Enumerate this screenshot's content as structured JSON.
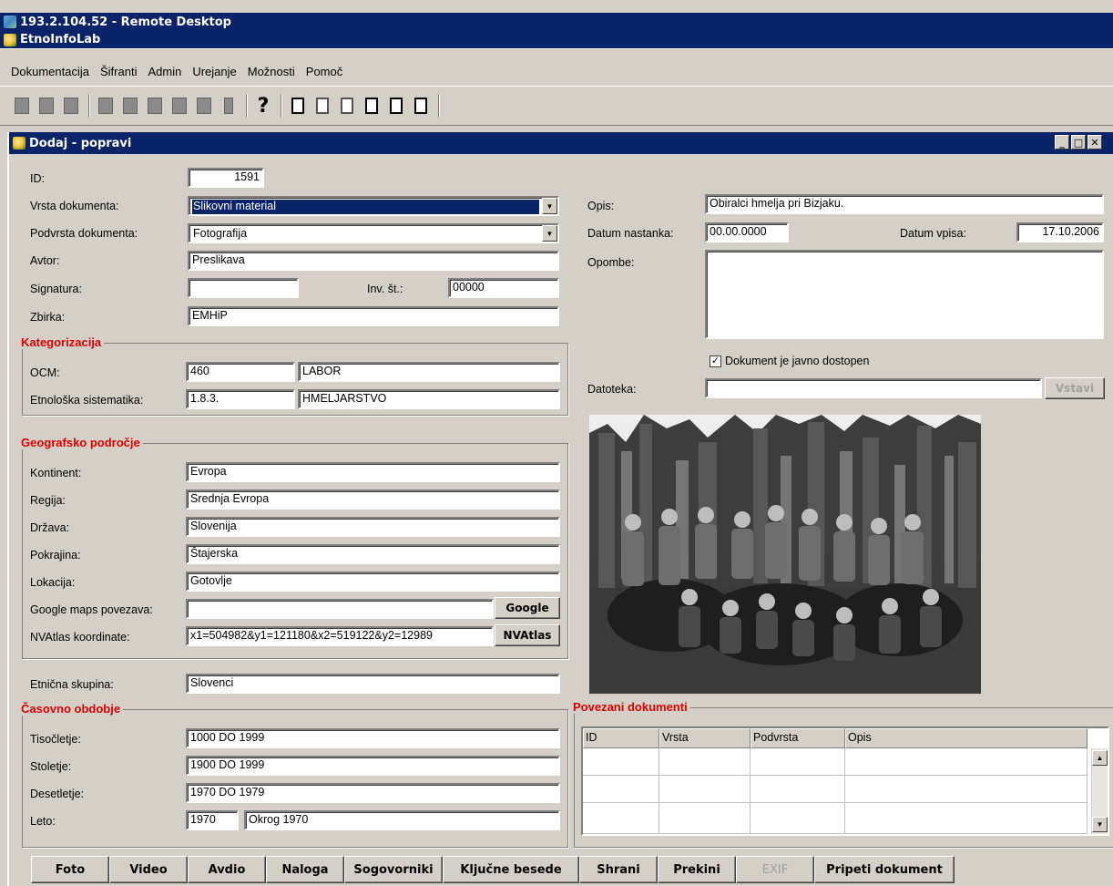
{
  "window": {
    "rdp_title": "193.2.104.52 - Remote Desktop",
    "app_title": "EtnoInfoLab"
  },
  "menu": [
    "Dokumentacija",
    "Šifranti",
    "Admin",
    "Urejanje",
    "Možnosti",
    "Pomoč"
  ],
  "dialog": {
    "title": "Dodaj - popravi"
  },
  "form": {
    "id_label": "ID:",
    "id_value": "1591",
    "vrsta_label": "Vrsta dokumenta:",
    "vrsta_value": "Slikovni material",
    "podvrsta_label": "Podvrsta dokumenta:",
    "podvrsta_value": "Fotografija",
    "avtor_label": "Avtor:",
    "avtor_value": "Preslikava",
    "signatura_label": "Signatura:",
    "signatura_value": "",
    "inv_label": "Inv. št.:",
    "inv_value": "00000",
    "zbirka_label": "Zbirka:",
    "zbirka_value": "EMHiP",
    "opis_label": "Opis:",
    "opis_value": "Obiralci hmelja pri Bizjaku.",
    "datum_nastanka_label": "Datum nastanka:",
    "datum_nastanka_value": "00.00.0000",
    "datum_vpisa_label": "Datum vpisa:",
    "datum_vpisa_value": "17.10.2006",
    "opombe_label": "Opombe:",
    "opombe_value": "",
    "javno_label": "Dokument je javno dostopen",
    "javno_checked": "✓",
    "datoteka_label": "Datoteka:",
    "datoteka_value": "",
    "vstavi_label": "Vstavi"
  },
  "kategorizacija": {
    "title": "Kategorizacija",
    "ocm_label": "OCM:",
    "ocm_code": "460",
    "ocm_name": "LABOR",
    "etno_label": "Etnološka sistematika:",
    "etno_code": "1.8.3.",
    "etno_name": "HMELJARSTVO"
  },
  "geo": {
    "title": "Geografsko področje",
    "kontinent_label": "Kontinent:",
    "kontinent": "Evropa",
    "regija_label": "Regija:",
    "regija": "Srednja Evropa",
    "drzava_label": "Država:",
    "drzava": "Slovenija",
    "pokrajina_label": "Pokrajina:",
    "pokrajina": "Štajerska",
    "lokacija_label": "Lokacija:",
    "lokacija": "Gotovlje",
    "google_label": "Google maps povezava:",
    "google_value": "",
    "google_btn": "Google",
    "nv_label": "NVAtlas koordinate:",
    "nv_value": "x1=504982&y1=121180&x2=519122&y2=12989",
    "nv_btn": "NVAtlas",
    "etnicna_label": "Etnična skupina:",
    "etnicna": "Slovenci"
  },
  "cas": {
    "title": "Časovno obdobje",
    "tisoc_label": "Tisočletje:",
    "tisoc": "1000 DO 1999",
    "stol_label": "Stoletje:",
    "stol": "1900 DO 1999",
    "deset_label": "Desetletje:",
    "deset": "1970 DO 1979",
    "leto_label": "Leto:",
    "leto": "1970",
    "leto_opis": "Okrog 1970"
  },
  "povezani": {
    "title": "Povezani dokumenti",
    "columns": [
      "ID",
      "Vrsta",
      "Podvrsta",
      "Opis"
    ]
  },
  "buttons": [
    "Foto",
    "Video",
    "Avdio",
    "Naloga",
    "Sogovorniki",
    "Ključne besede",
    "Shrani",
    "Prekini",
    "EXIF",
    "Pripeti dokument"
  ],
  "colors": {
    "titlebar": "#0a246a",
    "face": "#d4d0c8",
    "group_title": "#e00000"
  }
}
